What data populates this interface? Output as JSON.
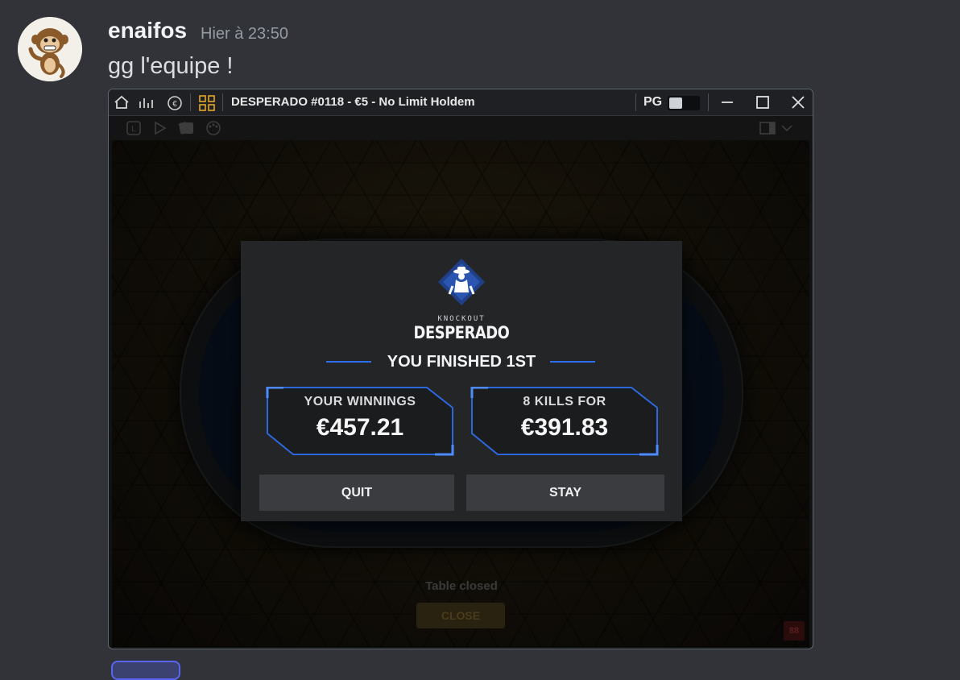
{
  "message": {
    "username": "enaifos",
    "timestamp": "Hier à 23:50",
    "text": "gg l'equipe !"
  },
  "window": {
    "title": "DESPERADO #0118 - €5 - No Limit Holdem",
    "pg_label": "PG",
    "pg_toggle_on": false,
    "controls": [
      "minimize-icon",
      "maximize-icon",
      "close-icon"
    ]
  },
  "dialog": {
    "logo_small": "KNOCKOUT",
    "logo_big": "DESPERADO",
    "heading": "YOU FINISHED 1ST",
    "winnings_label": "YOUR WINNINGS",
    "winnings_value": "€457.21",
    "kills_label": "8 KILLS FOR",
    "kills_value": "€391.83",
    "quit_label": "QUIT",
    "stay_label": "STAY"
  },
  "table": {
    "status": "Table closed",
    "close_label": "CLOSE",
    "badge": "88"
  },
  "colors": {
    "accent_blue": "#2e6ff0",
    "discord_bg": "#313338"
  }
}
